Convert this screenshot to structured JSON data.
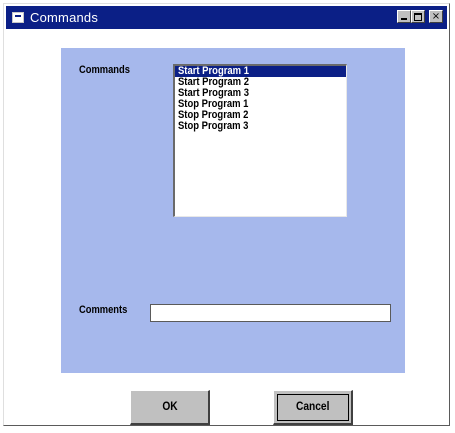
{
  "window": {
    "title": "Commands"
  },
  "form": {
    "commands_label": "Commands",
    "comments_label": "Comments",
    "comments_value": ""
  },
  "commands_list": {
    "items": [
      "Start Program 1",
      "Start Program 2",
      "Start Program 3",
      "Stop Program 1",
      "Stop Program 2",
      "Stop Program 3"
    ],
    "selected": "Start Program 1"
  },
  "buttons": {
    "ok_label": "OK",
    "cancel_label": "Cancel"
  },
  "colors": {
    "titlebar": "#0b1f86",
    "client_background": "#a6b8ec",
    "selection": "#0b1f86"
  }
}
